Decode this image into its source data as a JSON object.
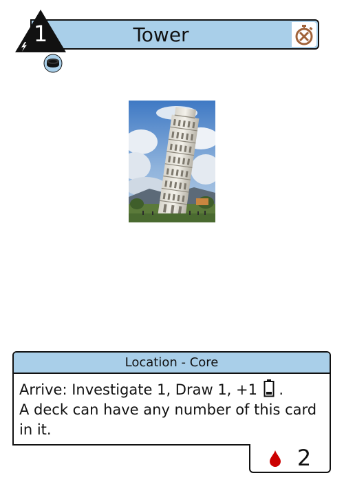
{
  "card": {
    "cost": "1",
    "title": "Tower",
    "type_line": "Location - Core",
    "ability": "Arrive: Investigate 1, Draw 1, +1",
    "ability_end": ".",
    "rule": "A deck can have any number of this card in it.",
    "blood_cost": "2"
  },
  "icons": {
    "cost_marker": "lightning-icon",
    "timer": "stopwatch-icon",
    "token": "coin-token-icon",
    "resource": "battery-icon",
    "blood": "blood-drop-icon"
  },
  "colors": {
    "accent": "#a9cfe9",
    "timer": "#a0633a",
    "blood": "#cc0000"
  }
}
